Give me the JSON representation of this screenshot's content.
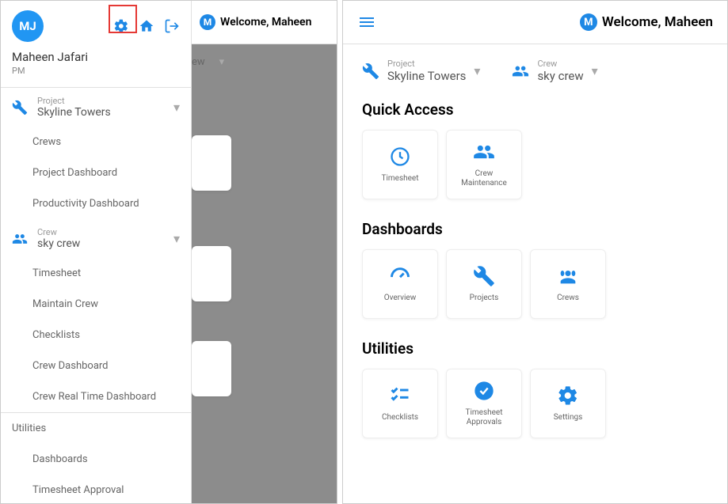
{
  "left": {
    "avatar_initials": "MJ",
    "user_name": "Maheen Jafari",
    "user_role": "PM",
    "project_label": "Project",
    "project_value": "Skyline Towers",
    "crew_label": "Crew",
    "crew_value": "sky crew",
    "nav_project": [
      "Crews",
      "Project Dashboard",
      "Productivity Dashboard"
    ],
    "nav_crew": [
      "Timesheet",
      "Maintain Crew",
      "Checklists",
      "Crew Dashboard",
      "Crew Real Time Dashboard"
    ],
    "utilities_title": "Utilities",
    "nav_util": [
      "Dashboards",
      "Timesheet Approval"
    ],
    "bg_welcome": "Welcome, Maheen",
    "bg_dd_trail": "ew"
  },
  "right": {
    "welcome": "Welcome, Maheen",
    "project_label": "Project",
    "project_value": "Skyline Towers",
    "crew_label": "Crew",
    "crew_value": "sky crew",
    "section_quick": "Quick Access",
    "section_dash": "Dashboards",
    "section_util": "Utilities",
    "cards_quick": [
      "Timesheet",
      "Crew\nMaintenance"
    ],
    "cards_dash": [
      "Overview",
      "Projects",
      "Crews"
    ],
    "cards_util": [
      "Checklists",
      "Timesheet\nApprovals",
      "Settings"
    ]
  },
  "logo_letter": "M"
}
